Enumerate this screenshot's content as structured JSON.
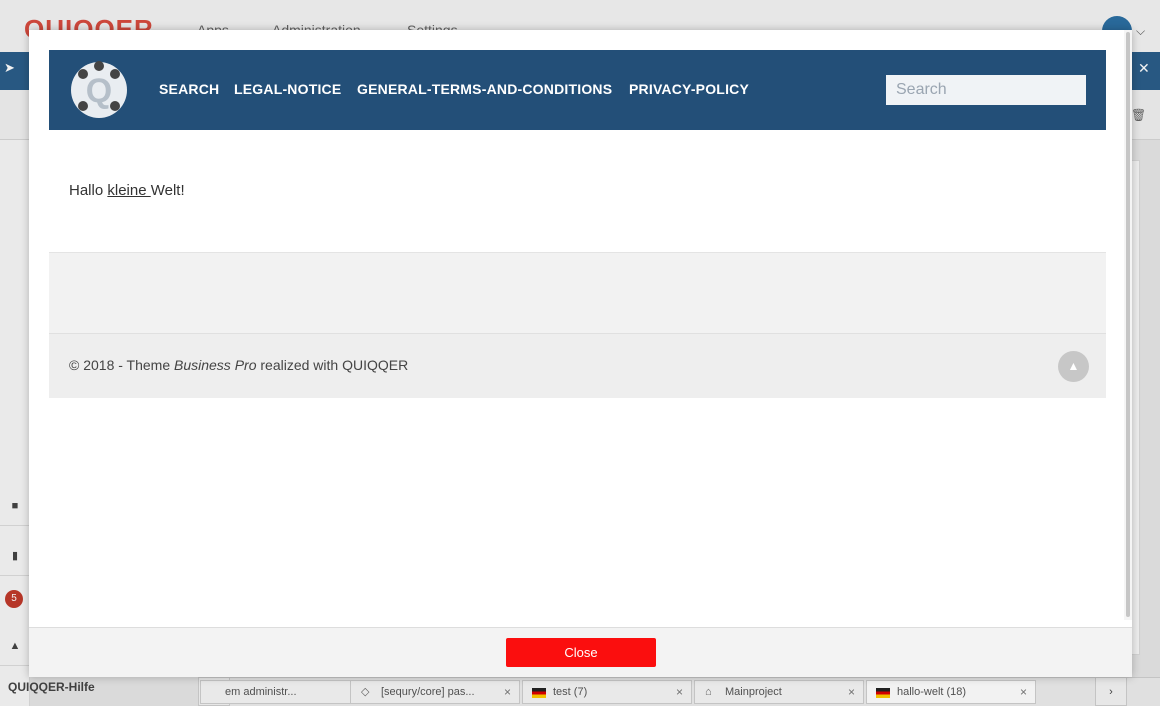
{
  "app": {
    "logo_text": "QUIQQER",
    "menu": [
      "Apps",
      "Administration",
      "Settings"
    ],
    "sidebar_badge": "5",
    "help_label": "QUIQQER-Hilfe"
  },
  "taskbar": {
    "left_arrow": "‹",
    "right_arrow": "›",
    "items": [
      {
        "label": "em administr...",
        "icon": "window-icon"
      },
      {
        "label": "[sequry/core] pas...",
        "icon": "diamond-icon"
      },
      {
        "label": "test (7)",
        "icon": "flag-de"
      },
      {
        "label": "Mainproject",
        "icon": "home-icon"
      },
      {
        "label": "hallo-welt (18)",
        "icon": "flag-de"
      }
    ],
    "close_glyph": "×"
  },
  "site": {
    "nav": [
      "SEARCH",
      "LEGAL-NOTICE",
      "GENERAL-TERMS-AND-CONDITIONS",
      "PRIVACY-POLICY"
    ],
    "search_placeholder": "Search",
    "content": {
      "hallo": "Hallo",
      "link": "kleine ",
      "welt": "Welt!"
    },
    "footer": {
      "prefix": "© 2018 - Theme ",
      "theme": "Business Pro",
      "suffix": " realized with QUIQQER"
    }
  },
  "modal": {
    "close_label": "Close"
  },
  "colors": {
    "nav_bg": "#234f78",
    "close_btn": "#fb0e0e",
    "app_bluebar": "#2b5d8a"
  }
}
